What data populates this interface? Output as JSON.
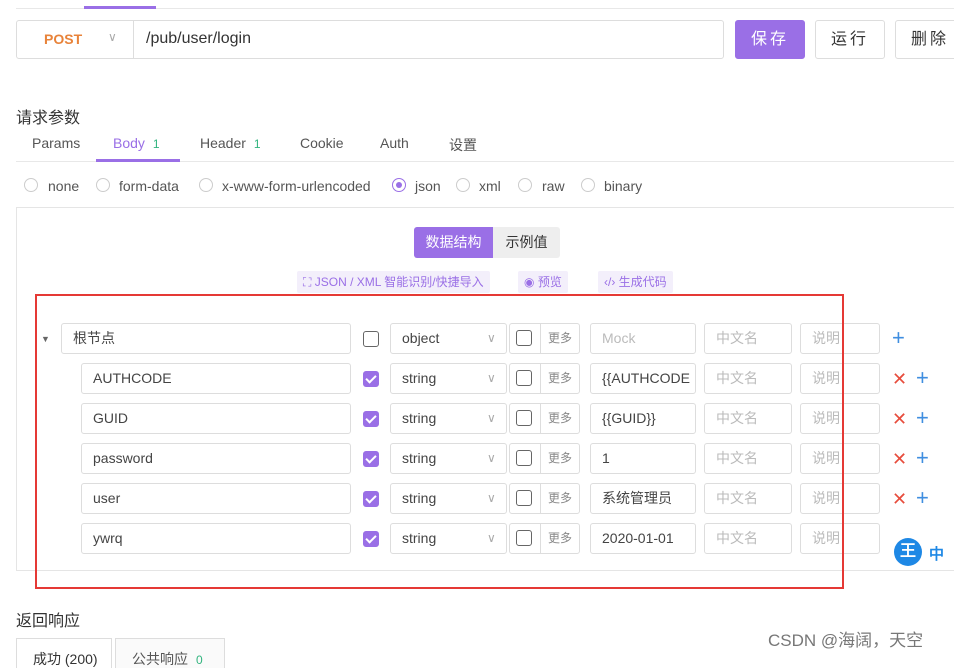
{
  "request": {
    "method": "POST",
    "url": "/pub/user/login",
    "buttons": {
      "save": "保存",
      "run": "运行",
      "delete": "删除"
    }
  },
  "params_section": {
    "title": "请求参数",
    "tabs": [
      {
        "label": "Params",
        "count": ""
      },
      {
        "label": "Body",
        "count": "1"
      },
      {
        "label": "Header",
        "count": "1"
      },
      {
        "label": "Cookie",
        "count": ""
      },
      {
        "label": "Auth",
        "count": ""
      },
      {
        "label": "设置",
        "count": ""
      }
    ],
    "active_tab": "Body"
  },
  "body_types": [
    "none",
    "form-data",
    "x-www-form-urlencoded",
    "json",
    "xml",
    "raw",
    "binary"
  ],
  "selected_body_type": "json",
  "view_toggle": {
    "structure": "数据结构",
    "example": "示例值"
  },
  "actions": {
    "import": "JSON / XML 智能识别/快捷导入",
    "preview": "预览",
    "generate": "生成代码"
  },
  "placeholders": {
    "mock": "Mock",
    "cn_name": "中文名",
    "desc": "说明"
  },
  "more_label": "更多",
  "root": {
    "name": "根节点",
    "type": "object",
    "required": false
  },
  "fields": [
    {
      "name": "AUTHCODE",
      "type": "string",
      "required": true,
      "value": "{{AUTHCODE"
    },
    {
      "name": "GUID",
      "type": "string",
      "required": true,
      "value": "{{GUID}}"
    },
    {
      "name": "password",
      "type": "string",
      "required": true,
      "value": "1"
    },
    {
      "name": "user",
      "type": "string",
      "required": true,
      "value": "系统管理员"
    },
    {
      "name": "ywrq",
      "type": "string",
      "required": true,
      "value": "2020-01-01"
    }
  ],
  "response_section": {
    "title": "返回响应",
    "tabs": [
      {
        "label": "成功 (200)"
      },
      {
        "label": "公共响应",
        "count": "0"
      }
    ]
  },
  "watermark": "CSDN @海阔，天空",
  "ime": {
    "logo": "王",
    "mode": "中"
  },
  "colors": {
    "accent": "#9a6fe6",
    "method": "#e8833a",
    "delete": "#e74c3c",
    "add": "#3f8ee0",
    "highlight_box": "#e53935"
  }
}
